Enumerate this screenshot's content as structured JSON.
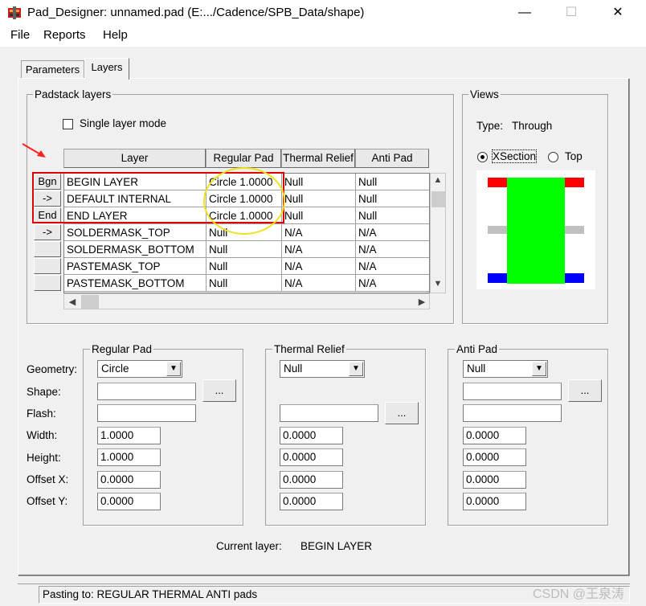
{
  "window": {
    "title": "Pad_Designer: unnamed.pad (E:.../Cadence/SPB_Data/shape)",
    "minimize": "—",
    "maximize": "☐",
    "close": "✕"
  },
  "menu": [
    "File",
    "Reports",
    "Help"
  ],
  "tabs": [
    {
      "label": "Parameters",
      "active": false
    },
    {
      "label": "Layers",
      "active": true
    }
  ],
  "padstack": {
    "group_title": "Padstack layers",
    "single_layer_label": "Single layer mode",
    "single_layer_checked": false,
    "columns": [
      "Layer",
      "Regular Pad",
      "Thermal Relief",
      "Anti Pad"
    ],
    "rows": [
      {
        "btn": "Bgn",
        "layer": "BEGIN LAYER",
        "regular": "Circle 1.0000",
        "thermal": "Null",
        "anti": "Null"
      },
      {
        "btn": "->",
        "layer": "DEFAULT INTERNAL",
        "regular": "Circle 1.0000",
        "thermal": "Null",
        "anti": "Null"
      },
      {
        "btn": "End",
        "layer": "END LAYER",
        "regular": "Circle 1.0000",
        "thermal": "Null",
        "anti": "Null"
      },
      {
        "btn": "->",
        "layer": "SOLDERMASK_TOP",
        "regular": "Null",
        "thermal": "N/A",
        "anti": "N/A"
      },
      {
        "btn": "",
        "layer": "SOLDERMASK_BOTTOM",
        "regular": "Null",
        "thermal": "N/A",
        "anti": "N/A"
      },
      {
        "btn": "",
        "layer": "PASTEMASK_TOP",
        "regular": "Null",
        "thermal": "N/A",
        "anti": "N/A"
      },
      {
        "btn": "",
        "layer": "PASTEMASK_BOTTOM",
        "regular": "Null",
        "thermal": "N/A",
        "anti": "N/A"
      }
    ]
  },
  "views": {
    "group_title": "Views",
    "type_label": "Type:",
    "type_value": "Through",
    "xsection_label": "XSection",
    "top_label": "Top",
    "selected": "XSection",
    "colors": {
      "pad_top": "#ff0000",
      "barrel": "#00ff00",
      "internal": "#c0c0c0",
      "pad_bottom": "#0000ff"
    }
  },
  "row_labels": {
    "geometry": "Geometry:",
    "shape": "Shape:",
    "flash": "Flash:",
    "width": "Width:",
    "height": "Height:",
    "offset_x": "Offset X:",
    "offset_y": "Offset Y:"
  },
  "regular_pad": {
    "title": "Regular Pad",
    "geometry": "Circle",
    "shape": "",
    "flash": "",
    "width": "1.0000",
    "height": "1.0000",
    "offset_x": "0.0000",
    "offset_y": "0.0000",
    "browse": "..."
  },
  "thermal_relief": {
    "title": "Thermal Relief",
    "geometry": "Null",
    "shape": "",
    "flash": "",
    "width": "0.0000",
    "height": "0.0000",
    "offset_x": "0.0000",
    "offset_y": "0.0000",
    "browse": "..."
  },
  "anti_pad": {
    "title": "Anti Pad",
    "geometry": "Null",
    "shape": "",
    "flash": "",
    "width": "0.0000",
    "height": "0.0000",
    "offset_x": "0.0000",
    "offset_y": "0.0000",
    "browse": "..."
  },
  "current_layer": {
    "label": "Current layer:",
    "value": "BEGIN LAYER"
  },
  "status": "Pasting to: REGULAR  THERMAL  ANTI  pads",
  "watermark": "CSDN @王泉涛",
  "annotations": {
    "box_color": "#e00000",
    "circle_color": "#f0e020",
    "arrow_color": "#ff2020"
  }
}
